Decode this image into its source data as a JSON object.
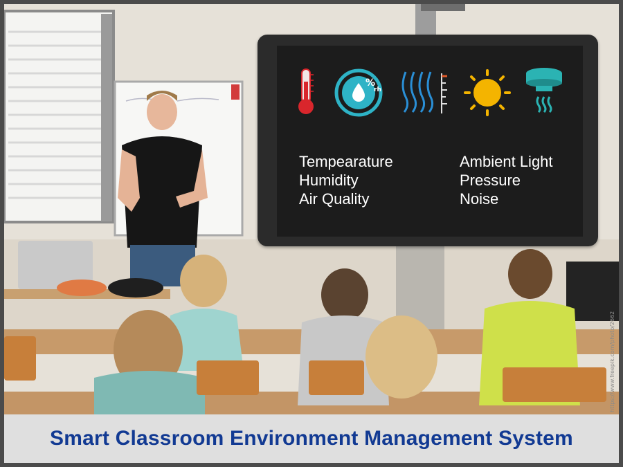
{
  "caption": "Smart Classroom Environment Management System",
  "screen": {
    "icons": [
      "thermometer-icon",
      "humidity-icon",
      "airflow-icon",
      "sun-icon",
      "smoke-detector-icon"
    ],
    "left_items": [
      "Tempearature",
      "Humidity",
      "Air Quality"
    ],
    "right_items": [
      "Ambient Light",
      "Pressure",
      "Noise"
    ],
    "humidity_icon_text": "%",
    "humidity_icon_sub": "rh"
  },
  "colors": {
    "caption": "#123a93",
    "caption_bar": "#dfdfdf",
    "screen_bg": "#1c1c1c",
    "thermometer": "#d9262c",
    "humidity": "#2eb3c6",
    "airflow": "#2a8fd6",
    "sun": "#f4b400",
    "smoke": "#2bb3b3"
  },
  "watermark": "https://www.freepik.com/photo/2662"
}
